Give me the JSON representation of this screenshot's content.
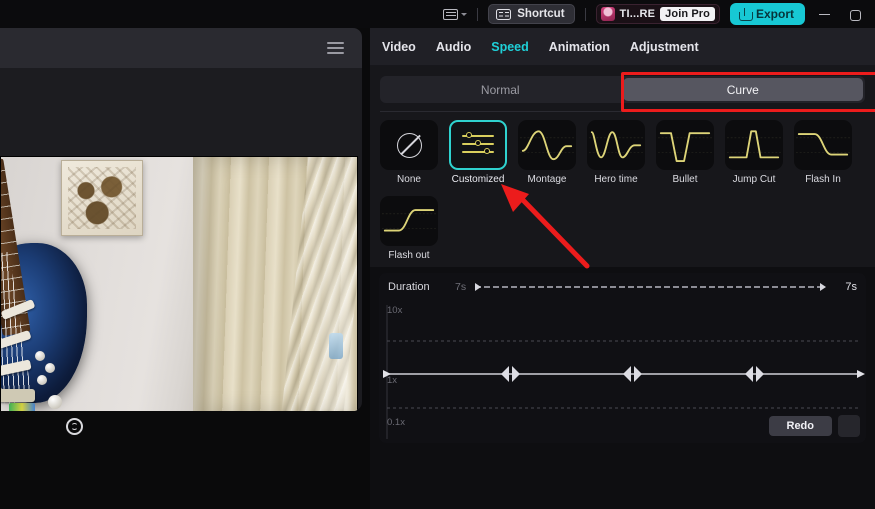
{
  "titlebar": {
    "keyboard_icon": "keyboard-icon",
    "dropdown_caret": "chevron-down-icon",
    "shortcut_label": "Shortcut",
    "shortcut_icon": "keyboard-shortcut-icon",
    "account_name": "TI...RE",
    "join_pro_label": "Join Pro",
    "export_label": "Export",
    "export_icon": "export-icon",
    "minimize_icon": "minimize-icon",
    "restore_icon": "restore-icon"
  },
  "tabs": [
    {
      "label": "Video",
      "active": false
    },
    {
      "label": "Audio",
      "active": false
    },
    {
      "label": "Speed",
      "active": true
    },
    {
      "label": "Animation",
      "active": false
    },
    {
      "label": "Adjustment",
      "active": false
    }
  ],
  "mode_switch": {
    "normal_label": "Normal",
    "curve_label": "Curve",
    "active": "Curve"
  },
  "presets": [
    {
      "label": "None",
      "icon": "no-speed-curve-icon",
      "selected": false
    },
    {
      "label": "Customized",
      "icon": "sliders-icon",
      "selected": true
    },
    {
      "label": "Montage",
      "icon": "curve-montage-icon",
      "selected": false
    },
    {
      "label": "Hero time",
      "icon": "curve-hero-time-icon",
      "selected": false
    },
    {
      "label": "Bullet",
      "icon": "curve-bullet-icon",
      "selected": false
    },
    {
      "label": "Jump Cut",
      "icon": "curve-jump-cut-icon",
      "selected": false
    },
    {
      "label": "Flash In",
      "icon": "curve-flash-in-icon",
      "selected": false
    },
    {
      "label": "Flash out",
      "icon": "curve-flash-out-icon",
      "selected": false
    }
  ],
  "duration": {
    "label": "Duration",
    "min_value": "7s",
    "max_value": "7s"
  },
  "curve_editor": {
    "axis_top": "10x",
    "axis_mid": "1x",
    "axis_bottom": "0.1x",
    "keyframe_count": 3
  },
  "editor_actions": {
    "redo_label": "Redo",
    "extra_button": "more-button"
  },
  "preview": {
    "menu_icon": "hamburger-menu-icon",
    "reset_icon": "reset-view-icon"
  },
  "annotations": {
    "curve_highlight": "red-rectangle-around-curve-tab",
    "arrow_to_customized": "red-arrow-pointing-to-customized-preset"
  },
  "colors": {
    "accent": "#1fd0d8",
    "export": "#17c8d4",
    "annotation": "#ec1c1c",
    "curve_stroke": "#ddd478"
  }
}
